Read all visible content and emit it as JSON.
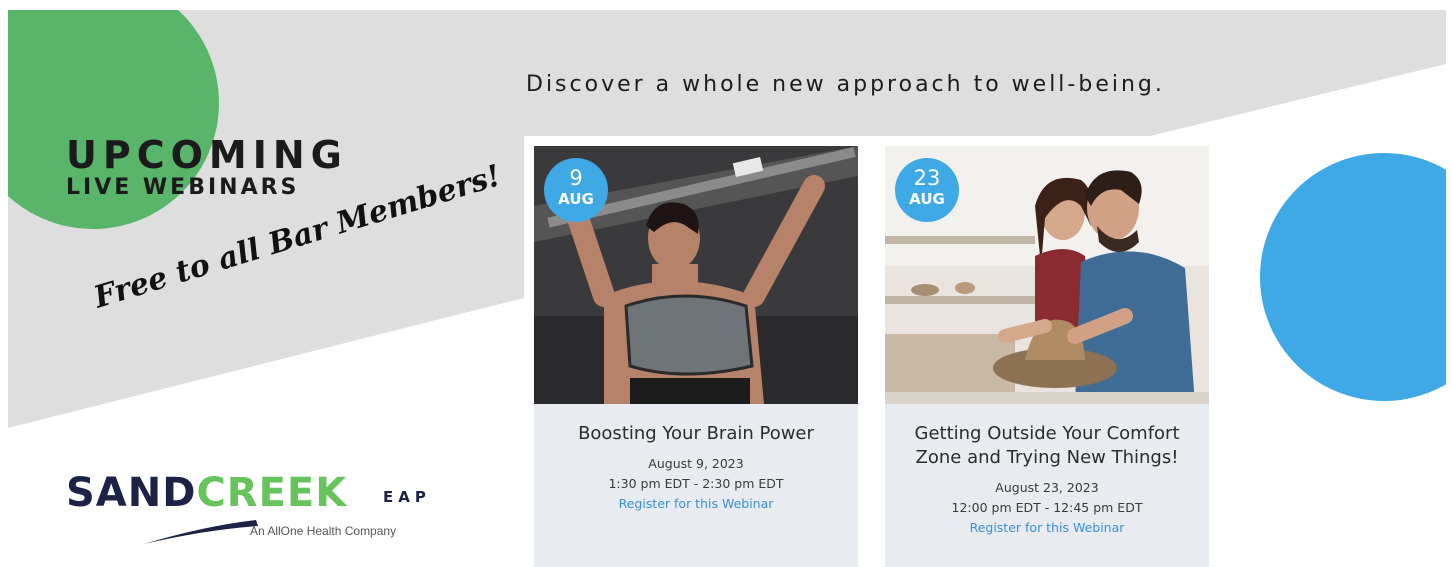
{
  "heading": {
    "line1": "UPCOMING",
    "line2": "LIVE WEBINARS"
  },
  "tagline": "Free to all Bar Members!",
  "discover": "Discover a whole new approach to well-being.",
  "webinars": [
    {
      "day": "9",
      "month": "AUG",
      "title": "Boosting Your Brain Power",
      "date": "August 9, 2023",
      "time": "1:30 pm EDT - 2:30 pm EDT",
      "link": "Register for this Webinar"
    },
    {
      "day": "23",
      "month": "AUG",
      "title": "Getting Outside Your Comfort Zone and Trying New Things!",
      "date": "August 23, 2023",
      "time": "12:00 pm EDT - 12:45 pm EDT",
      "link": "Register for this Webinar"
    }
  ],
  "logo": {
    "word1": "SAND",
    "word2": "CREEK",
    "suffix": "EAP",
    "subtitle": "An AllOne Health Company"
  },
  "colors": {
    "green_circle": "#58b56a",
    "blue_circle": "#3fa9e5",
    "gray_band": "#dedede",
    "link": "#3a8fd6"
  }
}
